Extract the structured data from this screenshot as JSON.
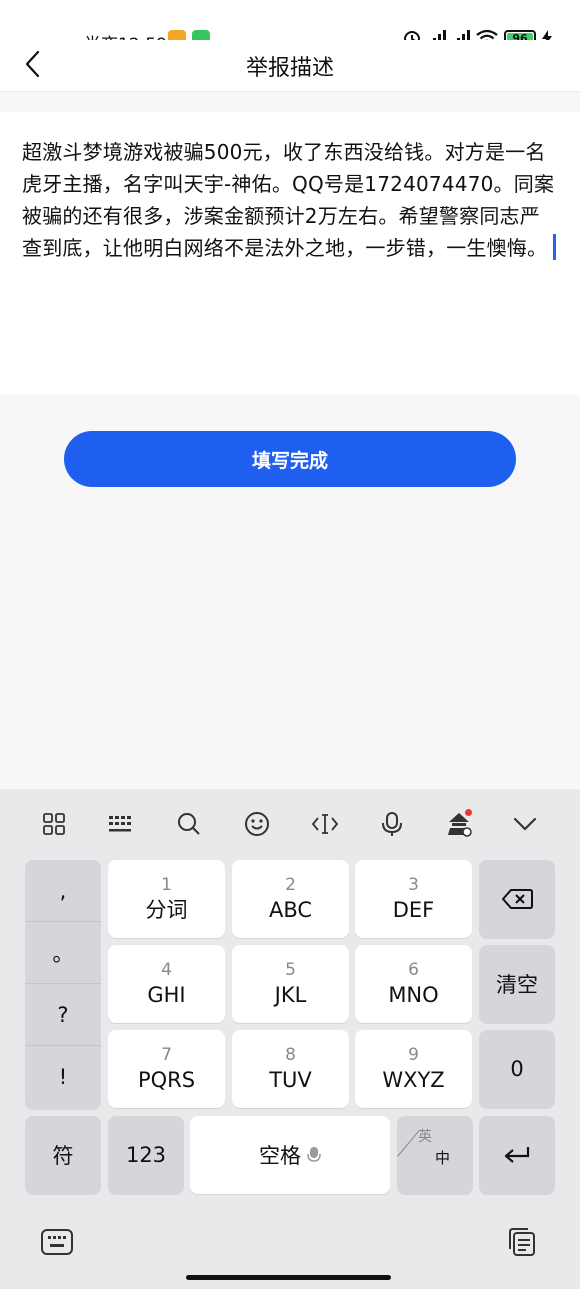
{
  "status_bar": {
    "time": "半夜12:59",
    "battery_level": "96",
    "icons": [
      "notes-app-icon",
      "android-app-icon",
      "alarm-icon",
      "hd-signal-icon",
      "hd-signal-icon",
      "wifi-icon",
      "battery-icon",
      "charging-icon"
    ]
  },
  "header": {
    "title": "举报描述"
  },
  "description": {
    "text": "超激斗梦境游戏被骗500元，收了东西没给钱。对方是一名虎牙主播，名字叫天宇-神佑。QQ号是1724074470。同案被骗的还有很多，涉案金额预计2万左右。希望警察同志严查到底，让他明白网络不是法外之地，一步错，一生懊悔。"
  },
  "submit_button": {
    "label": "填写完成",
    "color": "#1f5ff0"
  },
  "keyboard": {
    "toolbar": [
      "grid-icon",
      "keyboard-layout-icon",
      "search-icon",
      "emoji-icon",
      "text-cursor-icon",
      "microphone-icon",
      "skin-icon",
      "collapse-icon"
    ],
    "punctuation": [
      ",",
      "。",
      "?",
      "!"
    ],
    "rows": [
      [
        {
          "num": "1",
          "label": "分词"
        },
        {
          "num": "2",
          "label": "ABC"
        },
        {
          "num": "3",
          "label": "DEF"
        }
      ],
      [
        {
          "num": "4",
          "label": "GHI"
        },
        {
          "num": "5",
          "label": "JKL"
        },
        {
          "num": "6",
          "label": "MNO"
        }
      ],
      [
        {
          "num": "7",
          "label": "PQRS"
        },
        {
          "num": "8",
          "label": "TUV"
        },
        {
          "num": "9",
          "label": "WXYZ"
        }
      ]
    ],
    "clear_label": "清空",
    "zero_label": "0",
    "symbol_label": "符",
    "numbers_label": "123",
    "space_label": "空格",
    "lang_en": "英",
    "lang_zh": "中"
  }
}
